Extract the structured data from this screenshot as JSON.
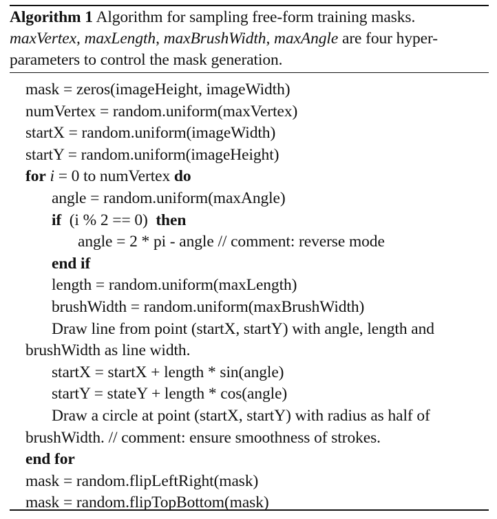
{
  "caption": {
    "label": "Algorithm 1",
    "title_part": "Algorithm for sampling free-form training masks.",
    "params": [
      "maxVertex",
      "maxLength",
      "maxBrushWidth",
      "maxAngle"
    ],
    "params_suffix": "are four hyper-",
    "line3": "parameters to control the mask generation."
  },
  "lines": [
    {
      "indent": 0,
      "text": "mask = zeros(imageHeight, imageWidth)"
    },
    {
      "indent": 0,
      "text": "numVertex = random.uniform(maxVertex)"
    },
    {
      "indent": 0,
      "text": "startX = random.uniform(imageWidth)"
    },
    {
      "indent": 0,
      "text": "startY = random.uniform(imageHeight)"
    },
    {
      "indent": 0,
      "kw1": "for",
      "var": "i",
      "mid": " = 0 to numVertex ",
      "kw2": "do"
    },
    {
      "indent": 1,
      "text": "angle = random.uniform(maxAngle)"
    },
    {
      "indent": 1,
      "kw1": "if",
      "mid": "  (i % 2 == 0)  ",
      "kw2": "then"
    },
    {
      "indent": 2,
      "text": "angle = 2 * pi - angle // comment: reverse mode"
    },
    {
      "indent": 1,
      "kw1": "end if"
    },
    {
      "indent": 1,
      "text": "length = random.uniform(maxLength)"
    },
    {
      "indent": 1,
      "text": "brushWidth = random.uniform(maxBrushWidth)"
    },
    {
      "indent": 1,
      "text": "Draw line from point (startX, startY) with angle, length and"
    },
    {
      "indent": 0,
      "text": "brushWidth as line width."
    },
    {
      "indent": 1,
      "text": "startX = startX + length * sin(angle)"
    },
    {
      "indent": 1,
      "text": "startY = stateY + length * cos(angle)"
    },
    {
      "indent": 1,
      "text": "Draw a circle at point (startX, startY) with radius as half of"
    },
    {
      "indent": 0,
      "text": "brushWidth. // comment: ensure smoothness of strokes."
    },
    {
      "indent": 0,
      "kw1": "end for"
    },
    {
      "indent": 0,
      "text": "mask = random.flipLeftRight(mask)"
    },
    {
      "indent": 0,
      "text": "mask = random.flipTopBottom(mask)"
    }
  ]
}
